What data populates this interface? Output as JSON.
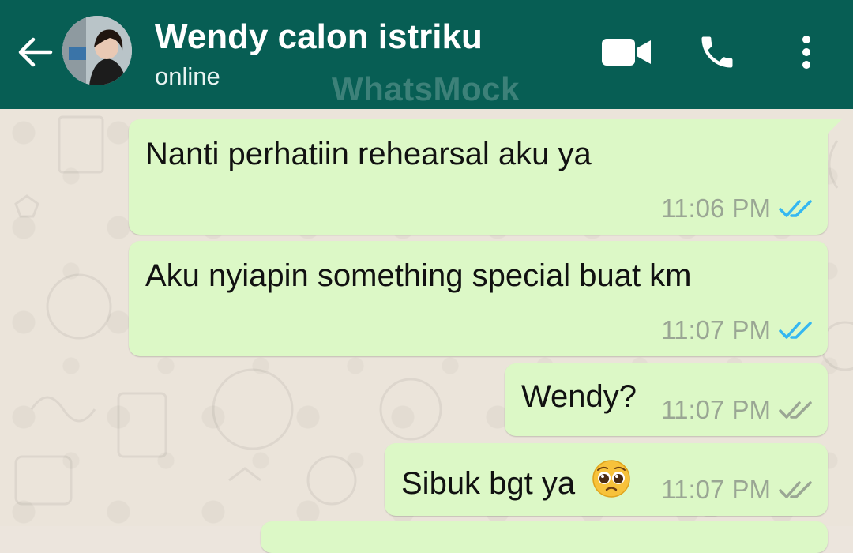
{
  "header": {
    "contact_name": "Wendy calon istriku",
    "status": "online",
    "watermark": "WhatsMock",
    "bg_color": "#075e54"
  },
  "messages": [
    {
      "text": "Nanti perhatiin rehearsal aku ya",
      "time": "11:06 PM",
      "ticks": "read"
    },
    {
      "text": "Aku nyiapin something special buat km",
      "time": "11:07 PM",
      "ticks": "read"
    },
    {
      "text": "Wendy?",
      "time": "11:07 PM",
      "ticks": "delivered"
    },
    {
      "text": "Sibuk bgt ya",
      "emoji": "pleading-face",
      "time": "11:07 PM",
      "ticks": "delivered"
    }
  ],
  "colors": {
    "bubble_out": "#dcf8c6",
    "read_tick": "#34b7f1",
    "delivered_tick": "#9aa694"
  },
  "icons": [
    "back-arrow-icon",
    "video-call-icon",
    "phone-icon",
    "more-vertical-icon",
    "double-check-icon",
    "pleading-face-emoji"
  ]
}
